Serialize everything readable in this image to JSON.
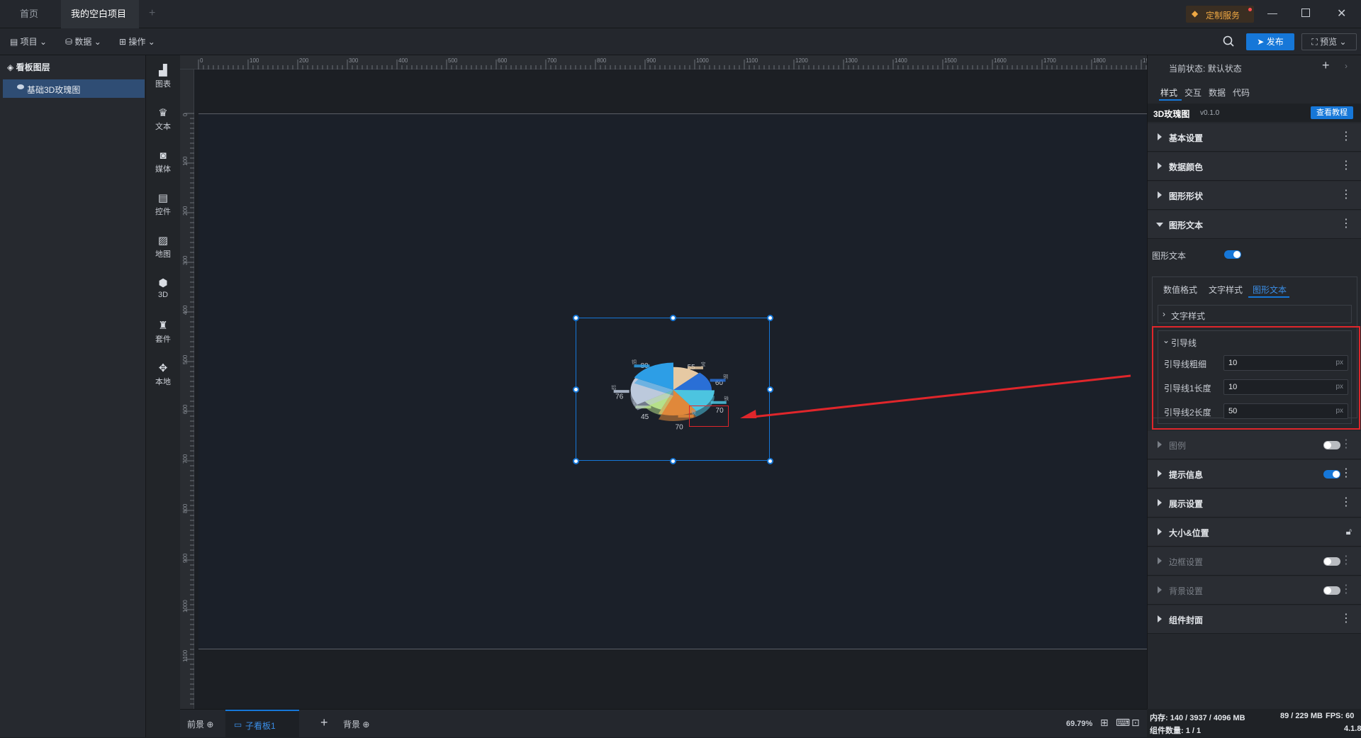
{
  "tabs": [
    {
      "label": "首页",
      "active": false
    },
    {
      "label": "我的空白项目",
      "active": true,
      "unsaved": true
    }
  ],
  "titlebar": {
    "custom_service": "定制服务"
  },
  "menubar": {
    "items": [
      "项目",
      "数据",
      "操作"
    ],
    "publish": "发布",
    "preview": "预览"
  },
  "layers": {
    "title": "看板图层",
    "items": [
      "基础3D玫瑰图"
    ]
  },
  "tools": [
    "图表",
    "文本",
    "媒体",
    "控件",
    "地图",
    "3D",
    "套件",
    "本地"
  ],
  "ruler": {
    "top": [
      "0",
      "100",
      "200",
      "300",
      "400",
      "500",
      "600",
      "700",
      "800",
      "900",
      "1000",
      "1100",
      "1200",
      "1300",
      "1400",
      "1500",
      "1600",
      "1700",
      "1800",
      "1900"
    ],
    "left": [
      "0",
      "100",
      "200",
      "300",
      "400",
      "500",
      "600",
      "700",
      "800",
      "900",
      "1000",
      "1100"
    ]
  },
  "chart_data": {
    "type": "pie",
    "categories": [
      "宝",
      "钢",
      "铁",
      "铁",
      "铁",
      "铝",
      "铜",
      "锌"
    ],
    "values": [
      55,
      60,
      70,
      70,
      45,
      76,
      80,
      60
    ],
    "value_labels": [
      "55",
      "60",
      "70",
      "70",
      "45",
      "76",
      "80"
    ],
    "colors": [
      "#e6c9a3",
      "#2a6fd6",
      "#4cc4e0",
      "#e0883a",
      "#b6e08a",
      "#bcc9dc",
      "#2d9ee6"
    ]
  },
  "bottom": {
    "foreground": "前景",
    "subboard": "子看板1",
    "background": "背景",
    "zoom": "69.79%"
  },
  "right": {
    "state_label": "当前状态:",
    "state_value": "默认状态",
    "tabs": [
      "样式",
      "交互",
      "数据",
      "代码"
    ],
    "component_name": "3D玫瑰图",
    "version": "v0.1.0",
    "tutorial": "查看教程",
    "sections": {
      "basic": "基本设置",
      "data_color": "数据颜色",
      "shape": "图形形状",
      "shape_text": "图形文本",
      "legend": "图例",
      "tooltip": "提示信息",
      "display": "展示设置",
      "size_pos": "大小&位置",
      "border": "边框设置",
      "bg": "背景设置",
      "cover": "组件封面"
    },
    "shape_text_toggle_label": "图形文本",
    "subtabs": [
      "数值格式",
      "文字样式",
      "图形文本"
    ],
    "text_style": "文字样式",
    "guide_line": {
      "title": "引导线",
      "fields": [
        {
          "label": "引导线粗细",
          "value": "10",
          "unit": "px"
        },
        {
          "label": "引导线1长度",
          "value": "10",
          "unit": "px"
        },
        {
          "label": "引导线2长度",
          "value": "50",
          "unit": "px"
        }
      ]
    }
  },
  "status": {
    "memory": "内存: 140 / 3937 / 4096 MB",
    "heap": "89 / 229 MB",
    "fps": "FPS: 60",
    "components": "组件数量: 1 / 1",
    "version": "4.1.8"
  }
}
